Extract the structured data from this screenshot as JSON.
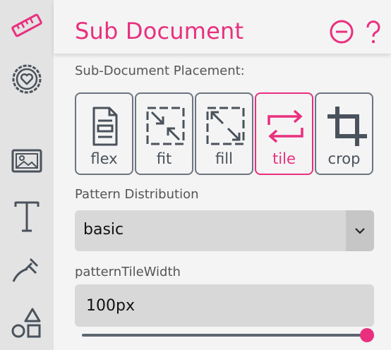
{
  "panel": {
    "title": "Sub Document"
  },
  "placement": {
    "label": "Sub-Document Placement:",
    "options": [
      {
        "label": "flex",
        "icon": "document-flex-icon",
        "active": false
      },
      {
        "label": "fit",
        "icon": "arrows-inward-icon",
        "active": false
      },
      {
        "label": "fill",
        "icon": "arrows-outward-icon",
        "active": false
      },
      {
        "label": "tile",
        "icon": "repeat-arrows-icon",
        "active": true
      },
      {
        "label": "crop",
        "icon": "crop-icon",
        "active": false
      }
    ]
  },
  "distribution": {
    "label": "Pattern Distribution",
    "value": "basic"
  },
  "tile_width": {
    "label": "patternTileWidth",
    "value": "100px",
    "slider_fraction": 1.0
  },
  "sidebar": {
    "items": [
      {
        "icon": "ruler-icon",
        "active": true
      },
      {
        "icon": "heart-badge-icon",
        "active": false
      },
      {
        "icon": "image-icon",
        "active": false
      },
      {
        "icon": "text-icon",
        "active": false
      },
      {
        "icon": "pen-nib-icon",
        "active": false
      },
      {
        "icon": "shapes-icon",
        "active": false
      }
    ]
  },
  "colors": {
    "accent": "#e8307e",
    "icon": "#4a525c",
    "rail": "#e3e3e3"
  }
}
